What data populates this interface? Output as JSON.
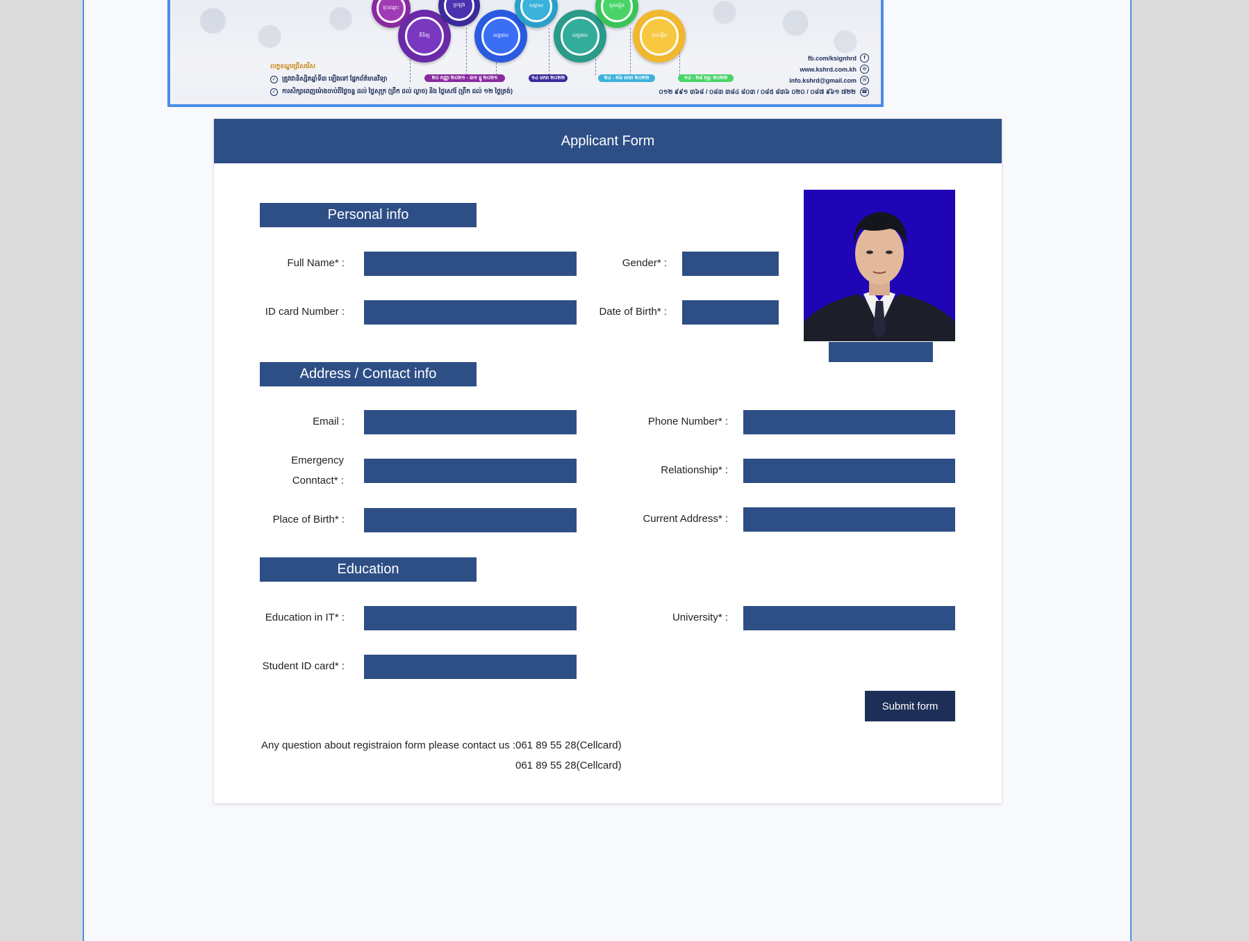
{
  "banner": {
    "criteria_title": "លក្ខខណ្ឌជ្រើសរើស",
    "criteria": [
      "ត្រូវជានិស្សិតឆ្នាំទី៣ ឡើងទៅ ផ្នែកព័ត៌មានវិទ្យា",
      "ការសិក្សាពេញម៉ោងចាប់ពីថ្ងៃចន្ទ ដល់ ថ្ងៃសុក្រ (ព្រឹក ដល់ ល្ងាច) និង ថ្ងៃសៅរ៍ (ព្រឹក ដល់ ១២ ថ្ងៃត្រង់)"
    ],
    "pills": [
      "២០ កញ្ញា ២០២១ - ៣១ ធ្នូ ២០២១",
      "១៤ មករា ២០២២",
      "២៤ - ២៦ មករា ២០២២",
      "១៤ - ២៨ កុម្ភៈ ២០២២"
    ],
    "contacts": [
      {
        "text": "fb.com/ksignhrd",
        "icon": "facebook-icon",
        "glyph": "f"
      },
      {
        "text": "www.kshrd.com.kh",
        "icon": "web-icon",
        "glyph": "⊖"
      },
      {
        "text": "info.kshrd@gmail.com",
        "icon": "mail-icon",
        "glyph": "✉"
      }
    ],
    "phones": "០១២ ៩៩១ ៣៦៨ / ០៨៣ ៣៨៤ ៨០៣ / ០៨៥ ៨៣៦ ០២០ / ០៨៧ ៩៦១ ៧២២"
  },
  "form": {
    "title": "Applicant Form",
    "sections": {
      "personal": "Personal info",
      "address": "Address / Contact info",
      "education": "Education"
    },
    "labels": {
      "full_name": "Full Name* :",
      "gender": "Gender* :",
      "id_card": "ID card Number :",
      "dob": "Date of Birth* :",
      "email": "Email :",
      "phone": "Phone Number* :",
      "emergency_1": "Emergency",
      "emergency_2": "Conntact* :",
      "relationship": "Relationship* :",
      "place_of_birth": "Place of Birth* :",
      "current_address": "Current Address* :",
      "education_it": "Education in IT* :",
      "university": "University* :",
      "student_id": "Student ID card* :"
    },
    "submit_label": "Submit form",
    "help_text": "Any question about registraion form please contact us :",
    "help_phone_1": "061 89 55 28(Cellcard)",
    "help_phone_2": "061 89 55 28(Cellcard)"
  },
  "colors": {
    "primary": "#2e4f86",
    "submit": "#1e2f57",
    "photo_background": "#1f05b5",
    "page_border": "#4a8de8"
  }
}
